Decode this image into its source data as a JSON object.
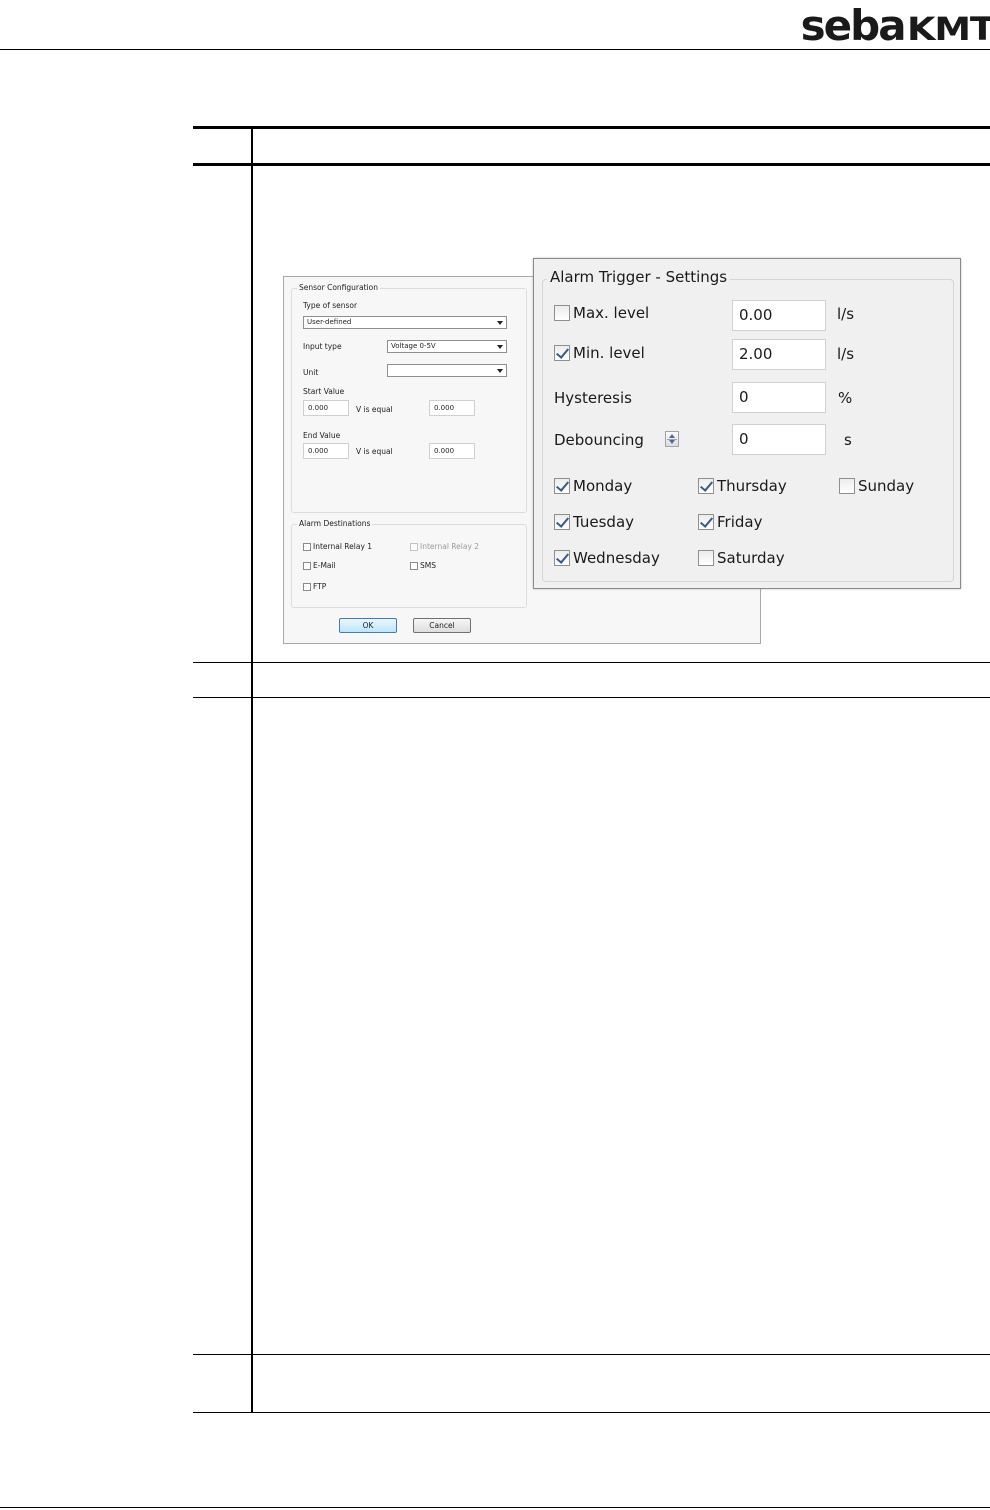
{
  "header": {
    "logo_part1": "seba",
    "logo_part2": "KMT"
  },
  "sensor_config_dialog": {
    "group_title": "Sensor Configuration",
    "type_of_sensor_label": "Type of sensor",
    "type_of_sensor_value": "User-defined",
    "input_type_label": "Input type",
    "input_type_value": "Voltage 0-5V",
    "unit_label": "Unit",
    "unit_value": "",
    "start_value_label": "Start Value",
    "start_value_input": "0.000",
    "start_equal_label": "V is equal",
    "start_equal_input": "0.000",
    "end_value_label": "End Value",
    "end_value_input": "0.000",
    "end_equal_label": "V is equal",
    "end_equal_input": "0.000",
    "alarm_group_title": "Alarm Destinations",
    "destinations": [
      {
        "label": "Internal Relay 1",
        "checked": false,
        "enabled": true
      },
      {
        "label": "Internal Relay 2",
        "checked": false,
        "enabled": false
      },
      {
        "label": "E-Mail",
        "checked": false,
        "enabled": true
      },
      {
        "label": "SMS",
        "checked": false,
        "enabled": true
      },
      {
        "label": "FTP",
        "checked": false,
        "enabled": true
      }
    ],
    "ok_label": "OK",
    "cancel_label": "Cancel"
  },
  "alarm_trigger_dialog": {
    "group_title": "Alarm Trigger - Settings",
    "max_level_label": "Max. level",
    "max_level_checked": false,
    "max_level_value": "0.00",
    "max_level_unit": "l/s",
    "min_level_label": "Min. level",
    "min_level_checked": true,
    "min_level_value": "2.00",
    "min_level_unit": "l/s",
    "hysteresis_label": "Hysteresis",
    "hysteresis_value": "0",
    "hysteresis_unit": "%",
    "debouncing_label": "Debouncing",
    "debouncing_value": "0",
    "debouncing_unit": "s",
    "days": {
      "monday": {
        "label": "Monday",
        "checked": true
      },
      "tuesday": {
        "label": "Tuesday",
        "checked": true
      },
      "wednesday": {
        "label": "Wednesday",
        "checked": true
      },
      "thursday": {
        "label": "Thursday",
        "checked": true
      },
      "friday": {
        "label": "Friday",
        "checked": true
      },
      "saturday": {
        "label": "Saturday",
        "checked": false
      },
      "sunday": {
        "label": "Sunday",
        "checked": false
      }
    }
  }
}
